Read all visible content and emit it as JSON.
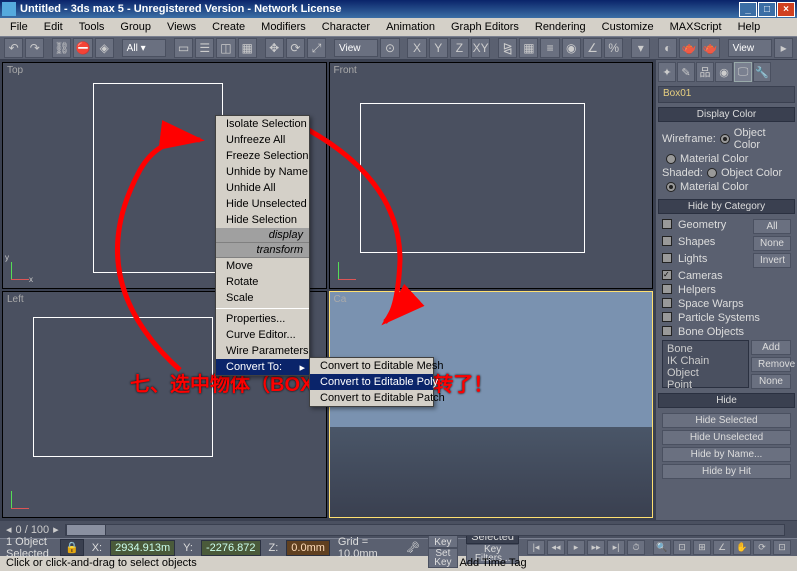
{
  "title": "Untitled - 3ds max 5 - Unregistered Version - Network License",
  "menu": [
    "File",
    "Edit",
    "Tools",
    "Group",
    "Views",
    "Create",
    "Modifiers",
    "Character",
    "Animation",
    "Graph Editors",
    "Rendering",
    "Customize",
    "MAXScript",
    "Help"
  ],
  "toolbar_view": "View",
  "viewports": {
    "top": "Top",
    "front": "Front",
    "left": "Left",
    "cam": "Ca"
  },
  "context_menu": {
    "isolate": "Isolate Selection",
    "unfreeze_all": "Unfreeze All",
    "freeze_sel": "Freeze Selection",
    "unhide_name": "Unhide by Name",
    "unhide_all": "Unhide All",
    "hide_unsel": "Hide Unselected",
    "hide_sel": "Hide Selection",
    "hdr_display": "display",
    "hdr_transform": "transform",
    "move": "Move",
    "rotate": "Rotate",
    "scale": "Scale",
    "properties": "Properties...",
    "curve_editor": "Curve Editor...",
    "wire_params": "Wire Parameters",
    "convert_to": "Convert To:"
  },
  "submenu": {
    "mesh": "Convert to Editable Mesh",
    "poly": "Convert to Editable Poly",
    "patch": "Convert to Editable Patch"
  },
  "panel": {
    "object_name": "Box01",
    "display_color": {
      "header": "Display Color",
      "wireframe": "Wireframe:",
      "shaded": "Shaded:",
      "object": "Object Color",
      "material": "Material Color"
    },
    "hide_cat": {
      "header": "Hide by Category",
      "geometry": "Geometry",
      "shapes": "Shapes",
      "lights": "Lights",
      "cameras": "Cameras",
      "helpers": "Helpers",
      "spacewarps": "Space Warps",
      "particles": "Particle Systems",
      "bone_obj": "Bone Objects",
      "all": "All",
      "none": "None",
      "invert": "Invert",
      "list_bone": "Bone",
      "list_ik": "IK Chain Object",
      "list_point": "Point",
      "add": "Add",
      "remove": "Remove",
      "none2": "None"
    },
    "hide": {
      "header": "Hide",
      "hide_sel": "Hide Selected",
      "hide_unsel": "Hide Unselected",
      "hide_name": "Hide by Name...",
      "hide_hit": "Hide by Hit"
    }
  },
  "track": {
    "pos": "0 / 100"
  },
  "status": {
    "selection": "1 Object Selected",
    "x_lbl": "X:",
    "x": "2934.913m",
    "y_lbl": "Y:",
    "y": "-2276.872",
    "z_lbl": "Z:",
    "z": "0.0mm",
    "grid": "Grid = 10.0mm",
    "autokey": "Auto Key",
    "setkey": "Set Key",
    "selected": "Selected",
    "add_time": "Add Time Tag",
    "key_filters": "Key Filters..."
  },
  "prompt": "Click or click-and-drag to select objects",
  "annotation": "七、选中物体（BOX）右键，将它转了！"
}
